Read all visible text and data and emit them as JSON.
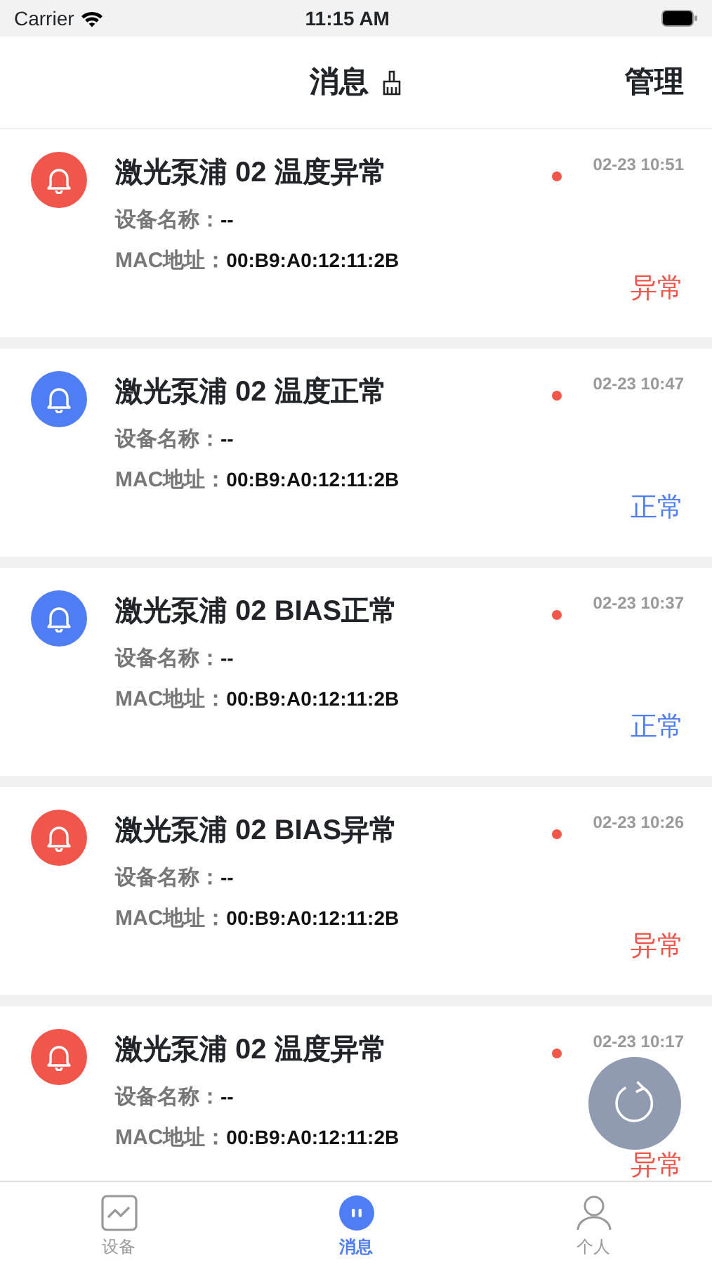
{
  "status_bar": {
    "carrier": "Carrier",
    "time": "11:15 AM"
  },
  "header": {
    "title": "消息",
    "action": "管理"
  },
  "messages": [
    {
      "title": "激光泵浦 02 温度异常",
      "kind": "abnormal",
      "unread": true,
      "time": "02-23 10:51",
      "name_label": "设备名称：",
      "name_value": "--",
      "mac_label": "MAC地址：",
      "mac_value": "00:B9:A0:12:11:2B",
      "status": "异常"
    },
    {
      "title": "激光泵浦 02 温度正常",
      "kind": "normal",
      "unread": true,
      "time": "02-23 10:47",
      "name_label": "设备名称：",
      "name_value": "--",
      "mac_label": "MAC地址：",
      "mac_value": "00:B9:A0:12:11:2B",
      "status": "正常"
    },
    {
      "title": "激光泵浦 02 BIAS正常",
      "kind": "normal",
      "unread": true,
      "time": "02-23 10:37",
      "name_label": "设备名称：",
      "name_value": "--",
      "mac_label": "MAC地址：",
      "mac_value": "00:B9:A0:12:11:2B",
      "status": "正常"
    },
    {
      "title": "激光泵浦 02 BIAS异常",
      "kind": "abnormal",
      "unread": true,
      "time": "02-23 10:26",
      "name_label": "设备名称：",
      "name_value": "--",
      "mac_label": "MAC地址：",
      "mac_value": "00:B9:A0:12:11:2B",
      "status": "异常"
    },
    {
      "title": "激光泵浦 02 温度异常",
      "kind": "abnormal",
      "unread": true,
      "time": "02-23 10:17",
      "name_label": "设备名称：",
      "name_value": "--",
      "mac_label": "MAC地址：",
      "mac_value": "00:B9:A0:12:11:2B",
      "status": "异常"
    }
  ],
  "tabs": [
    {
      "label": "设备",
      "kind": "chart",
      "selected": false
    },
    {
      "label": "消息",
      "kind": "message",
      "selected": true
    },
    {
      "label": "个人",
      "kind": "person",
      "selected": false
    }
  ]
}
